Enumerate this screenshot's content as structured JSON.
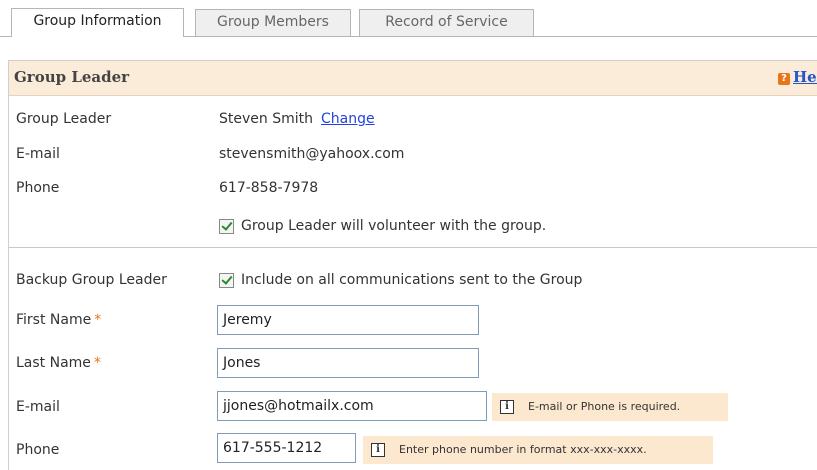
{
  "tabs": [
    {
      "label": "Group Information",
      "active": true
    },
    {
      "label": "Group Members",
      "active": false
    },
    {
      "label": "Record of Service",
      "active": false
    }
  ],
  "section": {
    "title": "Group Leader",
    "help_label": "Help",
    "help_icon": "help-icon"
  },
  "leader": {
    "name_label": "Group Leader",
    "name_value": "Steven Smith",
    "change_link": "Change",
    "email_label": "E-mail",
    "email_value": "stevensmith@yahoox.com",
    "phone_label": "Phone",
    "phone_value": "617-858-7978",
    "volunteer_checkbox": {
      "checked": true,
      "label": "Group Leader will volunteer with the group."
    }
  },
  "backup": {
    "heading_label": "Backup Group Leader",
    "include_checkbox": {
      "checked": true,
      "label": "Include on all communications sent to the Group"
    },
    "first_name_label": "First Name",
    "first_name_value": "Jeremy",
    "last_name_label": "Last Name",
    "last_name_value": "Jones",
    "required_marker": "*",
    "email_label": "E-mail",
    "email_value": "jjones@hotmailx.com",
    "email_hint": "E-mail or Phone is required.",
    "phone_label": "Phone",
    "phone_value": "617-555-1212",
    "phone_hint": "Enter phone number in format xxx-xxx-xxxx."
  },
  "colors": {
    "accent_orange": "#e8751a",
    "link_blue": "#2244dd",
    "header_bg": "#fbecd9",
    "hint_bg": "#fbe8cf"
  }
}
